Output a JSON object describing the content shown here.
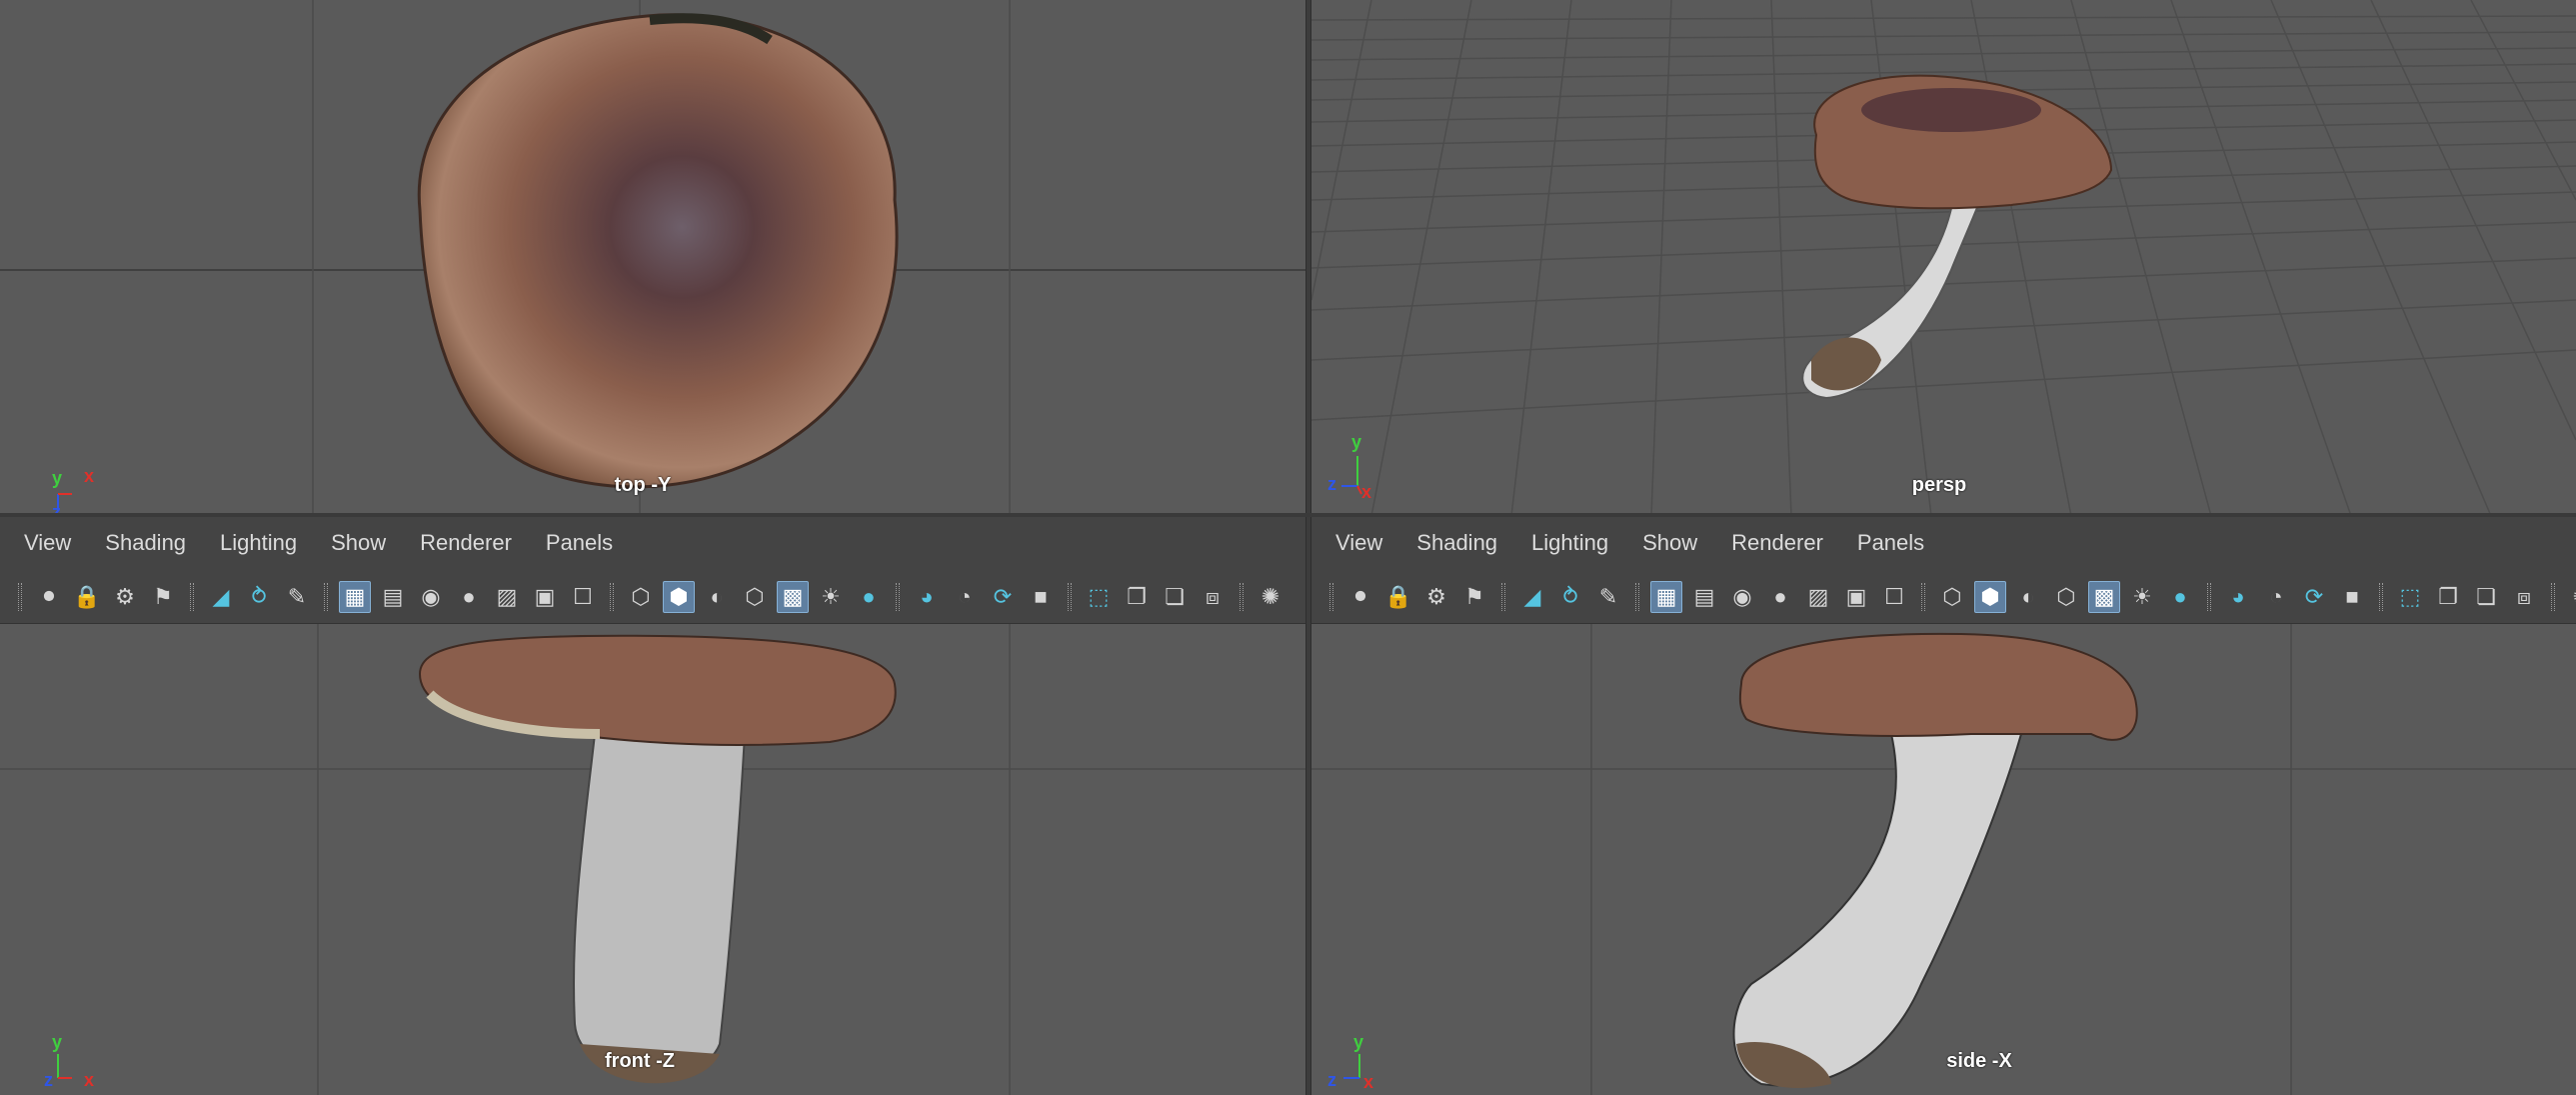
{
  "panes": {
    "top_left": {
      "camera_label": "top -Y",
      "axis_up": "y",
      "axis_right": "x",
      "axis_depth": "z"
    },
    "top_right": {
      "camera_label": "persp",
      "axis_up": "y",
      "axis_right": "x",
      "axis_depth": "z"
    },
    "bottom_left": {
      "camera_label": "front -Z",
      "axis_up": "y",
      "axis_right": "x",
      "axis_depth": "z"
    },
    "bottom_right": {
      "camera_label": "side -X",
      "axis_up": "y",
      "axis_right": "x",
      "axis_depth": "z"
    }
  },
  "panel_menu": {
    "view": "View",
    "shading": "Shading",
    "lighting": "Lighting",
    "show": "Show",
    "renderer": "Renderer",
    "panels": "Panels"
  },
  "toolbar_icons": [
    "select-camera-icon",
    "lock-camera-icon",
    "camera-attributes-icon",
    "bookmark-icon",
    "image-plane-icon",
    "2d-pan-zoom-icon",
    "grease-pencil-icon",
    "grid-icon",
    "film-gate-icon",
    "resolution-gate-icon",
    "gate-mask-icon",
    "field-chart-icon",
    "safe-action-icon",
    "safe-title-icon",
    "wireframe-icon",
    "smooth-shade-icon",
    "default-material-icon",
    "wireframe-on-shaded-icon",
    "textured-icon",
    "use-all-lights-icon",
    "shadows-icon",
    "screen-space-ao-icon",
    "motion-blur-icon",
    "anti-aliasing-icon",
    "depth-of-field-icon",
    "isolate-select-icon",
    "xray-icon",
    "xray-joints-icon",
    "xray-active-icon",
    "backface-culling-icon",
    "exposure-icon"
  ],
  "colors": {
    "viewport_bg": "#5a5a5a",
    "grid": "#474747",
    "ui_bg": "#444444",
    "active_button": "#5f7fa0",
    "axis_x": "#e0302a",
    "axis_y": "#3fcf3f",
    "axis_z": "#2f56e8"
  }
}
